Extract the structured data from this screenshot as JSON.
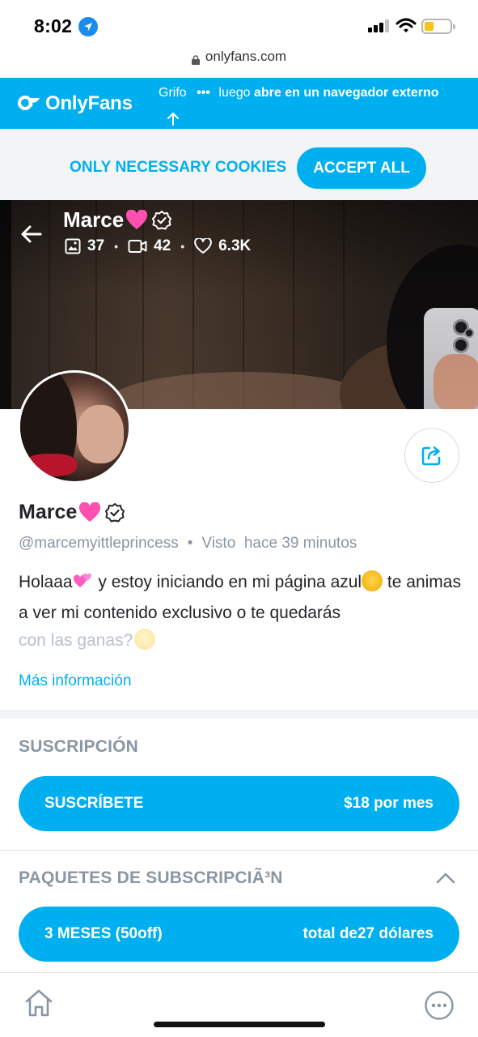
{
  "status_bar": {
    "time": "8:02",
    "battery_level": 0.3
  },
  "browser": {
    "url": "onlyfans.com"
  },
  "banner": {
    "logo_text": "OnlyFans",
    "hint_prefix": "Grifo",
    "hint_dots": "•••",
    "hint_middle": "luego",
    "hint_bold": "abre en un navegador externo"
  },
  "cookies": {
    "necessary_label": "ONLY NECESSARY COOKIES",
    "accept_label": "ACCEPT ALL"
  },
  "cover": {
    "name": "Marce",
    "photos": "37",
    "videos": "42",
    "likes": "6.3K"
  },
  "profile": {
    "name": "Marce",
    "handle": "@marcemyittleprincess",
    "separator": "•",
    "seen_label": "Visto",
    "seen_time": "hace 39 minutos",
    "bio_1": "Holaaa",
    "bio_2": " y estoy iniciando en mi página azul",
    "bio_3": " te animas a ver mi contenido exclusivo o te quedarás",
    "bio_4": "con las ganas?",
    "more_info": "Más información"
  },
  "subscription": {
    "title": "SUSCRIPCIÓN",
    "button_label": "SUSCRÍBETE",
    "price": "$18 por mes"
  },
  "bundles": {
    "title": "PAQUETES DE SUBSCRIPCIÃ³N",
    "bundle_label": "3 MESES (50off)",
    "bundle_total": "total de27 dólares"
  },
  "colors": {
    "brand": "#00aff0",
    "muted": "#8a96a3",
    "text": "#242529"
  },
  "icons": [
    "location-icon",
    "signal-icon",
    "wifi-icon",
    "battery-icon",
    "lock-icon",
    "onlyfans-logo-icon",
    "arrow-up-icon",
    "back-arrow-icon",
    "verified-icon",
    "image-icon",
    "video-icon",
    "heart-outline-icon",
    "share-icon",
    "chevron-up-icon",
    "home-icon",
    "more-icon"
  ]
}
